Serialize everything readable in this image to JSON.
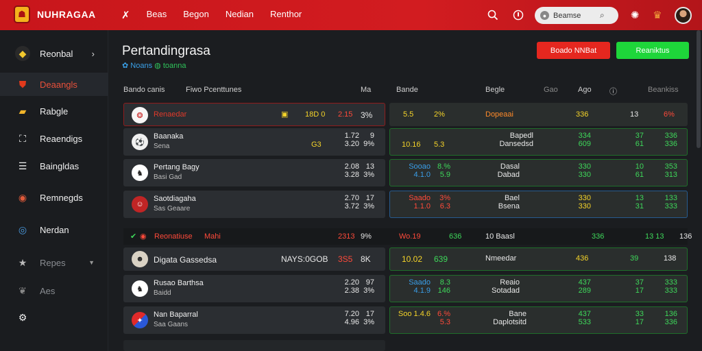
{
  "brand": {
    "name": "NUHRAGAA"
  },
  "topnav": {
    "items": [
      "Beas",
      "Begon",
      "Nedian",
      "Renthor"
    ]
  },
  "search": {
    "value": "Beamse"
  },
  "sidebar": {
    "items": [
      {
        "label": "Reonbal"
      },
      {
        "label": "Deaangls"
      },
      {
        "label": "Rabgle"
      },
      {
        "label": "Reaendigs"
      },
      {
        "label": "Baingldas"
      },
      {
        "label": "Remnegds"
      },
      {
        "label": "Nerdan"
      },
      {
        "label": "Repes"
      },
      {
        "label": "Aes"
      }
    ]
  },
  "page": {
    "title": "Pertandingrasa",
    "subtitle_a": "Noans",
    "subtitle_b": "toanna"
  },
  "actions": {
    "red": "Boado NNBat",
    "green": "Reaniktus"
  },
  "columns": {
    "c1": "Bando canis",
    "c2": "Fiwo Pcenttunes",
    "c3": "Ma",
    "c4": "Bande",
    "c5": "Begle",
    "c6": "Gao",
    "c7": "Ago",
    "c8": "Beankiss"
  },
  "rows": [
    {
      "team": "Renaedar",
      "sub": "",
      "a": "18D 0",
      "b": "2.15",
      "c": "3%",
      "r1": "5.5",
      "r2": "2%",
      "r3": "Dopeaai",
      "r4": "336",
      "r5": "13",
      "r6": "6%"
    },
    {
      "team": "Baanaka",
      "sub": "Sena",
      "a": "G3",
      "b": "1.72  3.20",
      "c": "9  9%",
      "r1": "10.16",
      "r2": "5.3",
      "r3": "Bapedl  Dansedsd",
      "r4": "334  609",
      "r5": "37  61",
      "r6": "336  336"
    },
    {
      "team": "Pertang Bagy",
      "sub": "Basi Gad",
      "a": "",
      "b": "2.08  3.28",
      "c": "13  3%",
      "r1": "Sooao 4.1.0",
      "r2": "8.%  5.9",
      "r3": "Dasal  Dabad",
      "r4": "330  330",
      "r5": "10  61",
      "r6": "353  313"
    },
    {
      "team": "Saotdiagaha",
      "sub": "Sas Geaare",
      "a": "",
      "b": "2.70  3.72",
      "c": "17  3%",
      "r1": "Saado  1.1.0",
      "r2": "3%  6.3",
      "r3": "Bael  Bsena",
      "r4": "330  330",
      "r5": "13  31",
      "r6": "133  333"
    },
    {
      "team": "Digata Gassedsa",
      "sub": "",
      "a": "NAYS:0GOB",
      "b": "3S5",
      "c": "8K",
      "r1": "10.02",
      "r2": "639",
      "r3": "Nmeedar",
      "r4": "436",
      "r5": "39",
      "r6": "138"
    },
    {
      "team": "Rusao Barthsa",
      "sub": "Baidd",
      "a": "",
      "b": "2.20  2.38",
      "c": "97  3%",
      "r1": "Saado 4.1.9",
      "r2": "8.3  146",
      "r3": "Reaio  Sotadad",
      "r4": "437  289",
      "r5": "37  17",
      "r6": "333  333"
    },
    {
      "team": "Nan Baparral",
      "sub": "Saa Gaans",
      "a": "",
      "b": "7.20  4.96",
      "c": "17  3%",
      "r1": "Soo 1.4.6",
      "r2": "6.%  5.3",
      "r3": "Bane  Daplotsitd",
      "r4": "437  533",
      "r5": "33  17",
      "r6": "136  336"
    }
  ],
  "banner": {
    "label": "Reonatiuse",
    "mid": "Mahi",
    "b": "2313",
    "c": "9%",
    "r1": "Wo.19",
    "r2": "636",
    "r3": "10  Baasl",
    "r4": "336",
    "r5": "13  13",
    "r6": "136"
  }
}
